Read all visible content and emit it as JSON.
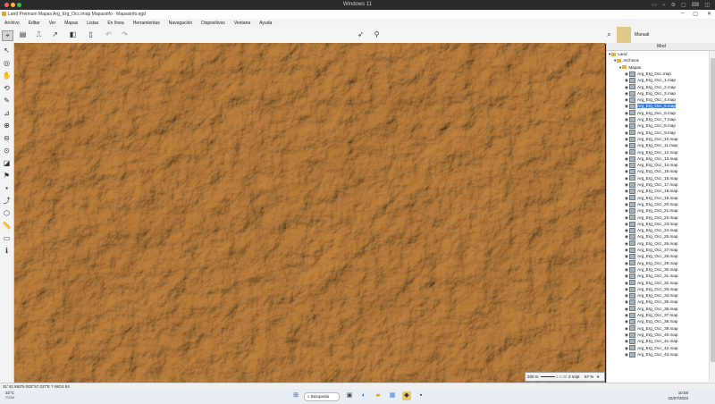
{
  "mac": {
    "title": "Windows 11"
  },
  "window": {
    "title": "Land Premium Mapas Arg_Erg_Occ.imap Mapasinfo · Mapasinfo.egd"
  },
  "menu": [
    "Archivo",
    "Editar",
    "Ver",
    "Mapas",
    "Listas",
    "En línea",
    "Herramientas",
    "Navegación",
    "Dispositivos",
    "Ventana",
    "Ayuda"
  ],
  "toolbar": {
    "mode_label": "Manual"
  },
  "panel": {
    "title": "Mod",
    "tree": [
      {
        "label": "Land",
        "level": 0,
        "type": "root"
      },
      {
        "label": "Archivos",
        "level": 1,
        "type": "folder"
      },
      {
        "label": "Mapas",
        "level": 2,
        "type": "folder"
      },
      {
        "label": "Arg_Erg_Occ.map",
        "level": 3,
        "type": "map"
      },
      {
        "label": "Arg_Erg_Occ_1.map",
        "level": 3,
        "type": "map"
      },
      {
        "label": "Arg_Erg_Occ_2.map",
        "level": 3,
        "type": "map"
      },
      {
        "label": "Arg_Erg_Occ_3.map",
        "level": 3,
        "type": "map"
      },
      {
        "label": "Arg_Erg_Occ_4.map",
        "level": 3,
        "type": "map"
      },
      {
        "label": "Arg_Erg_Occ_5.map",
        "level": 3,
        "type": "map",
        "selected": true
      },
      {
        "label": "Arg_Erg_Occ_6.map",
        "level": 3,
        "type": "map"
      },
      {
        "label": "Arg_Erg_Occ_7.map",
        "level": 3,
        "type": "map"
      },
      {
        "label": "Arg_Erg_Occ_8.map",
        "level": 3,
        "type": "map"
      },
      {
        "label": "Arg_Erg_Occ_9.map",
        "level": 3,
        "type": "map"
      },
      {
        "label": "Arg_Erg_Occ_10.map",
        "level": 3,
        "type": "map"
      },
      {
        "label": "Arg_Erg_Occ_11.map",
        "level": 3,
        "type": "map"
      },
      {
        "label": "Arg_Erg_Occ_12.map",
        "level": 3,
        "type": "map"
      },
      {
        "label": "Arg_Erg_Occ_13.map",
        "level": 3,
        "type": "map"
      },
      {
        "label": "Arg_Erg_Occ_14.map",
        "level": 3,
        "type": "map"
      },
      {
        "label": "Arg_Erg_Occ_15.map",
        "level": 3,
        "type": "map"
      },
      {
        "label": "Arg_Erg_Occ_16.map",
        "level": 3,
        "type": "map"
      },
      {
        "label": "Arg_Erg_Occ_17.map",
        "level": 3,
        "type": "map"
      },
      {
        "label": "Arg_Erg_Occ_18.map",
        "level": 3,
        "type": "map"
      },
      {
        "label": "Arg_Erg_Occ_19.map",
        "level": 3,
        "type": "map"
      },
      {
        "label": "Arg_Erg_Occ_20.map",
        "level": 3,
        "type": "map"
      },
      {
        "label": "Arg_Erg_Occ_21.map",
        "level": 3,
        "type": "map"
      },
      {
        "label": "Arg_Erg_Occ_22.map",
        "level": 3,
        "type": "map"
      },
      {
        "label": "Arg_Erg_Occ_23.map",
        "level": 3,
        "type": "map"
      },
      {
        "label": "Arg_Erg_Occ_24.map",
        "level": 3,
        "type": "map"
      },
      {
        "label": "Arg_Erg_Occ_25.map",
        "level": 3,
        "type": "map"
      },
      {
        "label": "Arg_Erg_Occ_26.map",
        "level": 3,
        "type": "map"
      },
      {
        "label": "Arg_Erg_Occ_27.map",
        "level": 3,
        "type": "map"
      },
      {
        "label": "Arg_Erg_Occ_28.map",
        "level": 3,
        "type": "map"
      },
      {
        "label": "Arg_Erg_Occ_29.map",
        "level": 3,
        "type": "map"
      },
      {
        "label": "Arg_Erg_Occ_30.map",
        "level": 3,
        "type": "map"
      },
      {
        "label": "Arg_Erg_Occ_31.map",
        "level": 3,
        "type": "map"
      },
      {
        "label": "Arg_Erg_Occ_32.map",
        "level": 3,
        "type": "map"
      },
      {
        "label": "Arg_Erg_Occ_33.map",
        "level": 3,
        "type": "map"
      },
      {
        "label": "Arg_Erg_Occ_34.map",
        "level": 3,
        "type": "map"
      },
      {
        "label": "Arg_Erg_Occ_35.map",
        "level": 3,
        "type": "map"
      },
      {
        "label": "Arg_Erg_Occ_36.map",
        "level": 3,
        "type": "map"
      },
      {
        "label": "Arg_Erg_Occ_37.map",
        "level": 3,
        "type": "map"
      },
      {
        "label": "Arg_Erg_Occ_38.map",
        "level": 3,
        "type": "map"
      },
      {
        "label": "Arg_Erg_Occ_39.map",
        "level": 3,
        "type": "map"
      },
      {
        "label": "Arg_Erg_Occ_40.map",
        "level": 3,
        "type": "map"
      },
      {
        "label": "Arg_Erg_Occ_41.map",
        "level": 3,
        "type": "map"
      },
      {
        "label": "Arg_Erg_Occ_42.map",
        "level": 3,
        "type": "map"
      },
      {
        "label": "Arg_Erg_Occ_43.map",
        "level": 3,
        "type": "map"
      }
    ]
  },
  "map": {
    "scale_left": "200 m",
    "scale_mid": "1:1 ml",
    "zoom": "2 m/pt",
    "zoom_percent": "67 %"
  },
  "status": {
    "coords": "31°42.992'N 003°57.037'E  ?  WGS 84"
  },
  "taskbar": {
    "temp": "32°C",
    "weather": "Calor",
    "search": "Búsqueda",
    "time": "10:58",
    "date": "02/07/2023"
  }
}
